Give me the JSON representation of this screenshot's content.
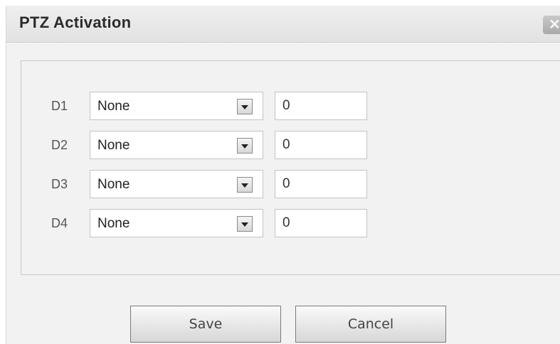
{
  "dialog": {
    "title": "PTZ Activation",
    "close_glyph": "✕"
  },
  "rows": [
    {
      "label": "D1",
      "select_value": "None",
      "number_value": "0"
    },
    {
      "label": "D2",
      "select_value": "None",
      "number_value": "0"
    },
    {
      "label": "D3",
      "select_value": "None",
      "number_value": "0"
    },
    {
      "label": "D4",
      "select_value": "None",
      "number_value": "0"
    }
  ],
  "buttons": {
    "save_label": "Save",
    "cancel_label": "Cancel"
  }
}
